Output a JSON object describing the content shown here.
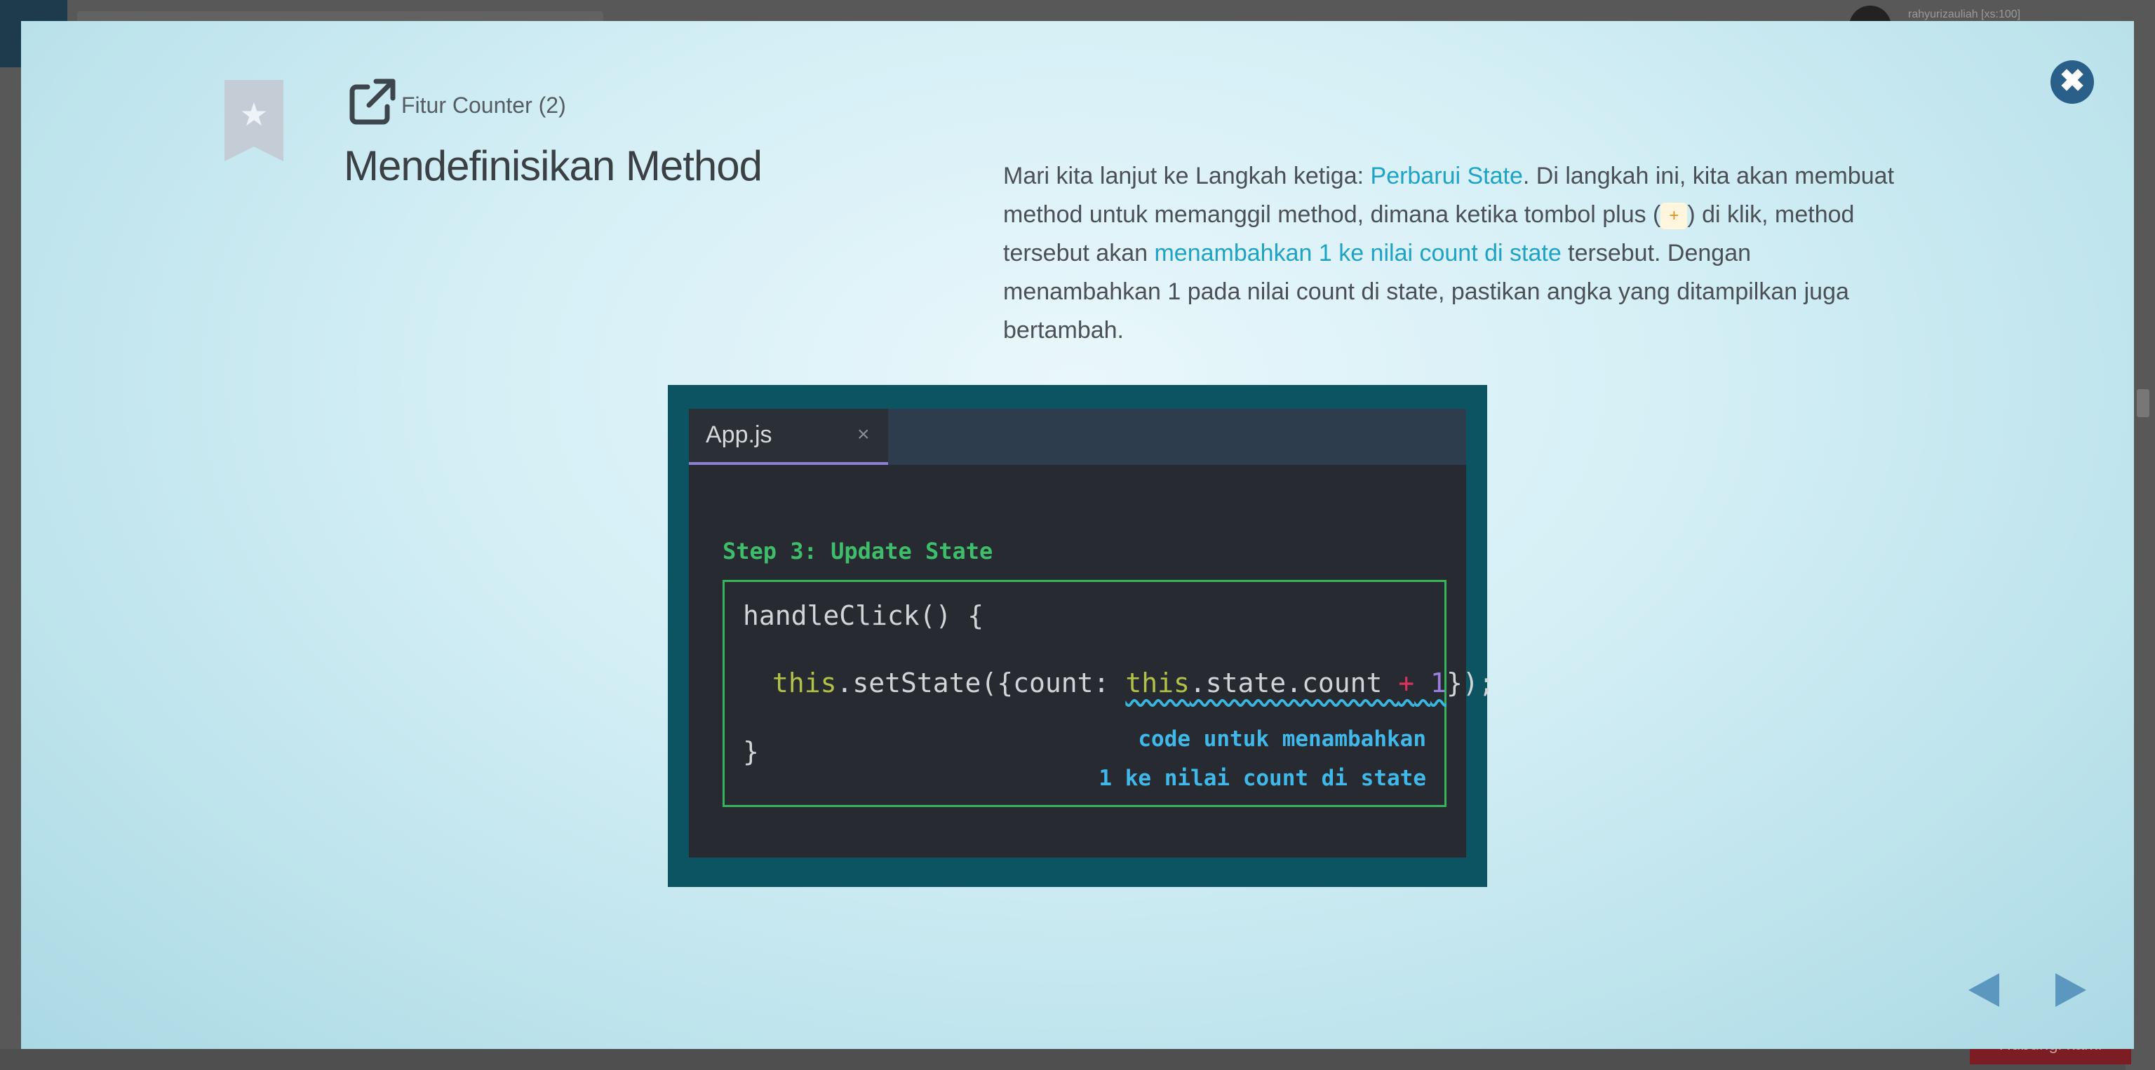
{
  "background": {
    "user_label": "rahyurizauliah [xs:100]",
    "bottom_button": "Hubungi kami"
  },
  "modal": {
    "subtitle": "Fitur Counter (2)",
    "title": "Mendefinisikan Method",
    "paragraph": {
      "p1": "Mari kita lanjut ke Langkah ketiga: ",
      "link1": "Perbarui State",
      "p2": ". Di langkah ini, kita akan membuat method untuk memanggil method, dimana ketika tombol plus (",
      "plus": "+",
      "p3": ") di klik, method tersebut akan ",
      "link2": "menambahkan 1 ke nilai count di state",
      "p4": " tersebut. Dengan menambahkan 1 pada nilai count di state, pastikan angka yang ditampilkan juga bertambah."
    },
    "figure": {
      "tab_label": "App.js",
      "tab_close": "×",
      "step_label": "Step 3: Update State",
      "code": {
        "line1": "handleClick() {",
        "this1": "this",
        "mid1": ".setState({count: ",
        "this2": "this",
        "mid2": ".state.count ",
        "plus": "+",
        "one": "1",
        "end": "});",
        "line3": "}"
      },
      "note_line1": "code untuk menambahkan",
      "note_line2": "1 ke nilai count di state"
    },
    "close_icon": "close-icon",
    "colors": {
      "link": "#1ea3c6",
      "close": "#2a5f8a",
      "step": "#3ebd6a",
      "note": "#3fb8ea"
    }
  }
}
